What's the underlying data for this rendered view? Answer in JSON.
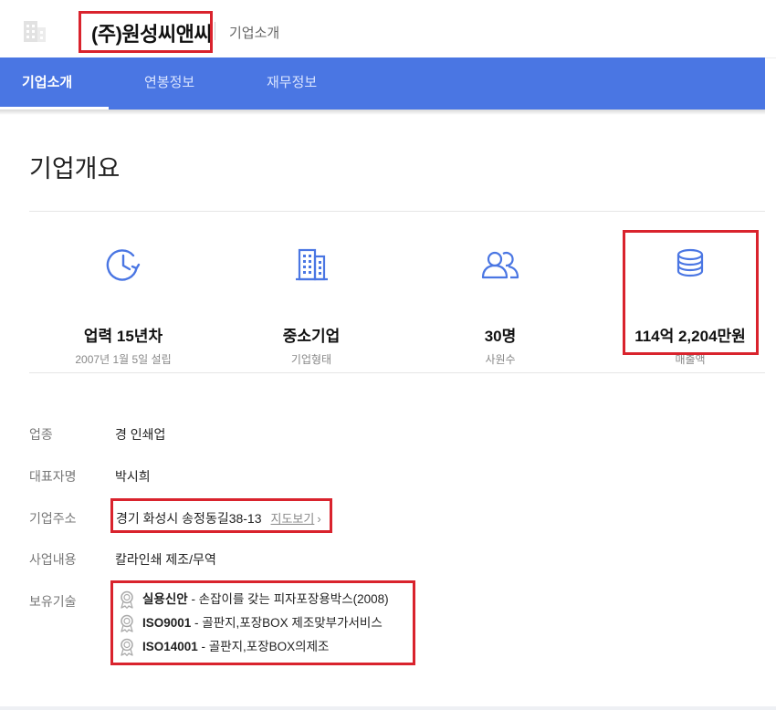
{
  "header": {
    "company_name": "(주)원성씨앤씨",
    "breadcrumb": "기업소개"
  },
  "tabs": [
    {
      "label": "기업소개",
      "active": true
    },
    {
      "label": "연봉정보",
      "active": false
    },
    {
      "label": "재무정보",
      "active": false
    }
  ],
  "overview": {
    "title": "기업개요",
    "stats": [
      {
        "icon": "clock-icon",
        "value": "업력 15년차",
        "sub": "2007년 1월 5일 설립"
      },
      {
        "icon": "building-icon",
        "value": "중소기업",
        "sub": "기업형태"
      },
      {
        "icon": "people-icon",
        "value": "30명",
        "sub": "사원수"
      },
      {
        "icon": "coins-icon",
        "value": "114억 2,204만원",
        "sub": "매출액"
      }
    ]
  },
  "info": {
    "industry_label": "업종",
    "industry_value": "경 인쇄업",
    "ceo_label": "대표자명",
    "ceo_value": "박시희",
    "address_label": "기업주소",
    "address_value": "경기 화성시 송정동길38-13",
    "map_link": "지도보기",
    "business_label": "사업내용",
    "business_value": "칼라인쇄 제조/무역",
    "tech_label": "보유기술",
    "technologies": [
      {
        "name": "실용신안",
        "desc": " - 손잡이를 갖는 피자포장용박스(2008)"
      },
      {
        "name": "ISO9001",
        "desc": " - 골판지,포장BOX 제조맞부가서비스"
      },
      {
        "name": "ISO14001",
        "desc": " - 골판지,포장BOX의제조"
      }
    ]
  },
  "colors": {
    "tab_bar": "#4a76e3",
    "accent_icon": "#4a76e3",
    "highlight_box": "#d9232d"
  }
}
